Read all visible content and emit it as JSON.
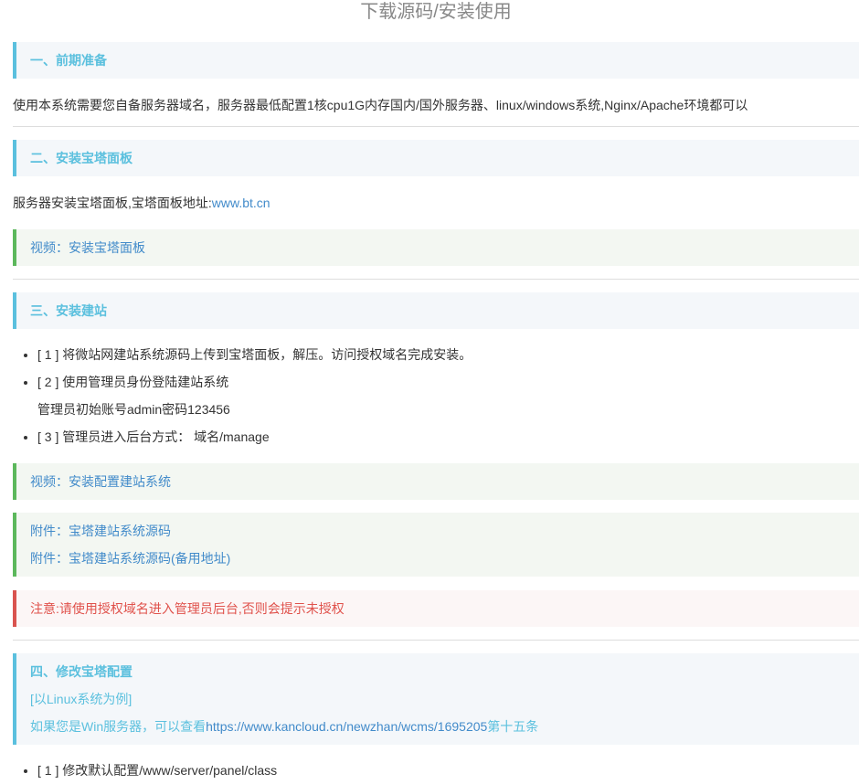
{
  "title": "下载源码/安装使用",
  "s1": {
    "heading": "一、前期准备",
    "text": "使用本系统需要您自备服务器域名，服务器最低配置1核cpu1G内存国内/国外服务器、linux/windows系统,Nginx/Apache环境都可以"
  },
  "s2": {
    "heading": "二、安装宝塔面板",
    "text": "服务器安装宝塔面板,宝塔面板地址:",
    "link": "www.bt.cn",
    "video": "视频：安装宝塔面板"
  },
  "s3": {
    "heading": "三、安装建站",
    "items": [
      "[ 1 ] 将微站网建站系统源码上传到宝塔面板，解压。访问授权域名完成安装。",
      "[ 2 ] 使用管理员身份登陆建站系统"
    ],
    "sub": "管理员初始账号admin密码123456",
    "item3": "[ 3 ] 管理员进入后台方式： 域名/manage",
    "video": "视频：安装配置建站系统",
    "attach1": "附件：宝塔建站系统源码",
    "attach2": "附件：宝塔建站系统源码(备用地址)",
    "warning": "注意:请使用授权域名进入管理员后台,否则会提示未授权"
  },
  "s4": {
    "heading": "四、修改宝塔配置",
    "note": "[以Linux系统为例]",
    "win_prefix": "如果您是Win服务器，可以查看",
    "win_link": "https://www.kancloud.cn/newzhan/wcms/1695205",
    "win_suffix": "第十五条",
    "item1": "[ 1 ] 修改默认配置/www/server/panel/class"
  }
}
